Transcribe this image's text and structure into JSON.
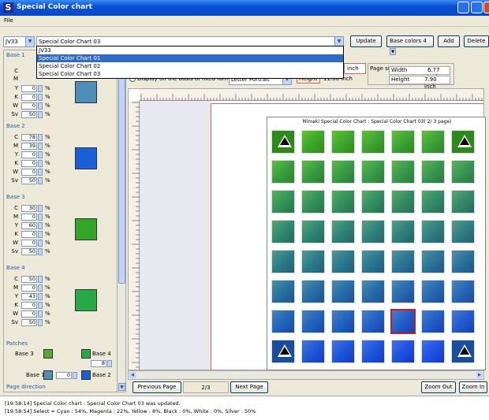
{
  "window": {
    "title": "Special Color chart"
  },
  "menu": {
    "file": "File"
  },
  "toolbar": {
    "model": "JV33",
    "chart_select": "Special Color Chart 03",
    "update": "Update",
    "base_colors_label": "Base colors",
    "base_colors_value": "4",
    "add": "Add",
    "delete": "Delete"
  },
  "dropdown": {
    "items": [
      "JV33",
      "Special Color Chart 01",
      "Special Color Chart 02",
      "Special Color Chart 03"
    ]
  },
  "page": {
    "display_label": "Display on the basis of fixed form",
    "form": "Letter Portrait",
    "height_label": "Height",
    "height_value": "11.00 inch",
    "inch": "inch",
    "size_label": "Page size",
    "width_label": "Width",
    "width_value": "6.77 inch",
    "pheight_label": "Height",
    "pheight_value": "7.90 inch"
  },
  "bases": [
    {
      "title": "Base 1",
      "color": "#4e8fb8",
      "values": {
        "C": "",
        "M": "",
        "Y": "0",
        "K": "0",
        "W": "0",
        "Sv": "50"
      }
    },
    {
      "title": "Base 2",
      "color": "#1a5ed8",
      "values": {
        "C": "78",
        "M": "39",
        "Y": "0",
        "K": "0",
        "W": "0",
        "Sv": "50"
      }
    },
    {
      "title": "Base 3",
      "color": "#33a52b",
      "values": {
        "C": "30",
        "M": "0",
        "Y": "60",
        "K": "0",
        "W": "0",
        "Sv": "50"
      }
    },
    {
      "title": "Base 4",
      "color": "#28a848",
      "values": {
        "C": "50",
        "M": "0",
        "Y": "43",
        "K": "0",
        "W": "0",
        "Sv": "50"
      }
    }
  ],
  "patches": {
    "title": "Patches",
    "base3": "Base 3",
    "base4": "Base 4",
    "base1": "Base 1",
    "base2": "Base 2",
    "count": "8",
    "base1val": "0",
    "direction": "Page direction"
  },
  "chart": {
    "title": "Mimaki Special Color Chart : Special Color Chart 03( 2/ 3 page)",
    "rows": 8,
    "cols": 7
  },
  "nav": {
    "prev": "Previous Page",
    "page": "2/3",
    "next": "Next Page",
    "zoom_out": "Zoom Out",
    "zoom_in": "Zoom In"
  },
  "status": {
    "line1": "[19:58:14] Special Color chart : Special Color Chart 03 was updated.",
    "line2": "[19:58:54] Select = Cyan : 54%, Magenta : 22%, Yellow : 8%, Black : 0%, White : 0%, Silver : 50%"
  }
}
